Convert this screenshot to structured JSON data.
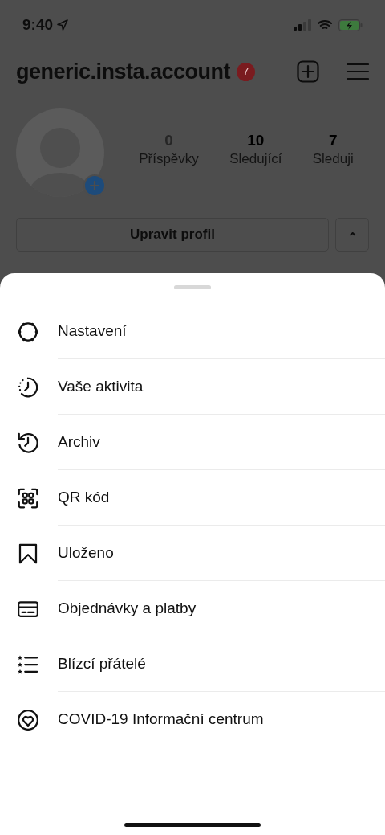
{
  "status_bar": {
    "time": "9:40"
  },
  "header": {
    "username": "generic.insta.account",
    "badge": "7"
  },
  "stats": [
    {
      "value": "0",
      "label": "Příspěvky",
      "muted": true
    },
    {
      "value": "10",
      "label": "Sledující",
      "muted": false
    },
    {
      "value": "7",
      "label": "Sleduji",
      "muted": false
    }
  ],
  "edit_button": "Upravit profil",
  "expand_button": "⌃",
  "menu": [
    {
      "label": "Nastavení",
      "kind": "settings"
    },
    {
      "label": "Vaše aktivita",
      "kind": "activity"
    },
    {
      "label": "Archiv",
      "kind": "archive"
    },
    {
      "label": "QR kód",
      "kind": "qr"
    },
    {
      "label": "Uloženo",
      "kind": "saved"
    },
    {
      "label": "Objednávky a platby",
      "kind": "card"
    },
    {
      "label": "Blízcí přátelé",
      "kind": "friends"
    },
    {
      "label": "COVID-19 Informační centrum",
      "kind": "covid"
    }
  ]
}
